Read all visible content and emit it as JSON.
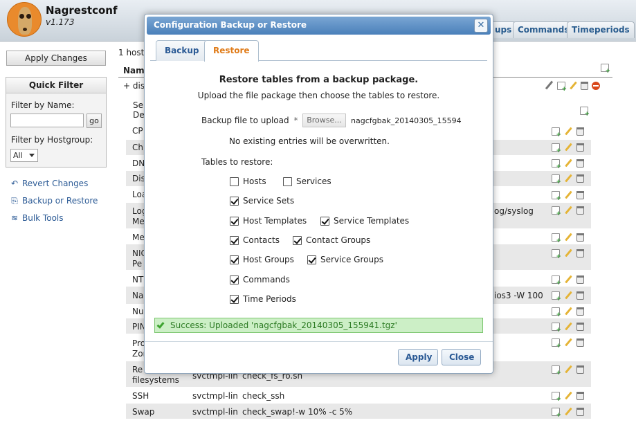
{
  "app": {
    "title": "Nagrestconf",
    "version": "v1.173"
  },
  "top_tabs": [
    {
      "label": "ups"
    },
    {
      "label": "Commands"
    },
    {
      "label": "Timeperiods"
    }
  ],
  "sidebar": {
    "apply_changes": "Apply Changes",
    "quick_filter": {
      "title": "Quick Filter",
      "filter_by_name_label": "Filter by Name:",
      "go_label": "go",
      "filter_by_hostgroup_label": "Filter by Hostgroup:",
      "hostgroup_selected": "All"
    },
    "links": [
      {
        "label": "Revert Changes",
        "icon": "revert-icon"
      },
      {
        "label": "Backup or Restore",
        "icon": "backup-icon"
      },
      {
        "label": "Bulk Tools",
        "icon": "layers-icon"
      }
    ]
  },
  "background": {
    "hosts_count": "1 hosts",
    "name_header": "Name",
    "disk_frag": "+ disk",
    "svc_header_1": "Se",
    "svc_header_2": "De",
    "col1": [
      "CP",
      "Ch",
      "DN",
      "Dis",
      "Loa",
      "Log",
      "Me",
      "Me",
      "NIC",
      "Pe",
      "NT",
      "Na",
      "Nu",
      "PIN",
      "Pro",
      "Zon"
    ],
    "visible_tail_frags": [
      "og/syslog",
      "ios3 -W 100"
    ],
    "rows": [
      {
        "c1": "Re",
        "c1b": "filesystems",
        "c2": "svctmpl-lin",
        "c3": "check_fs_ro.sh"
      },
      {
        "c1": "SSH",
        "c2": "svctmpl-lin",
        "c3": "check_ssh"
      },
      {
        "c1": "Swap",
        "c2": "svctmpl-lin",
        "c3": "check_swap!-w 10% -c 5%"
      }
    ]
  },
  "modal": {
    "title": "Configuration Backup or Restore",
    "close_glyph": "✕",
    "tabs": [
      {
        "label": "Backup"
      },
      {
        "label": "Restore"
      }
    ],
    "heading": "Restore tables from a backup package.",
    "subheading": "Upload the file package then choose the tables to restore.",
    "backup_file_label": "Backup file to upload",
    "required_mark": "*",
    "browse_label": "Browse...",
    "file_name": "nagcfgbak_20140305_15594",
    "no_overwrite_note": "No existing entries will be overwritten.",
    "tables_label": "Tables to restore:",
    "checkboxes": [
      {
        "label": "Hosts",
        "checked": false
      },
      {
        "label": "Services",
        "checked": false
      },
      {
        "label": "Service Sets",
        "checked": true
      },
      {
        "label": "Host Templates",
        "checked": true
      },
      {
        "label": "Service Templates",
        "checked": true
      },
      {
        "label": "Contacts",
        "checked": true
      },
      {
        "label": "Contact Groups",
        "checked": true
      },
      {
        "label": "Host Groups",
        "checked": true
      },
      {
        "label": "Service Groups",
        "checked": true
      },
      {
        "label": "Commands",
        "checked": true
      },
      {
        "label": "Time Periods",
        "checked": true
      }
    ],
    "success_message": "Success: Uploaded 'nagcfgbak_20140305_155941.tgz'",
    "apply_label": "Apply",
    "close_label": "Close"
  }
}
